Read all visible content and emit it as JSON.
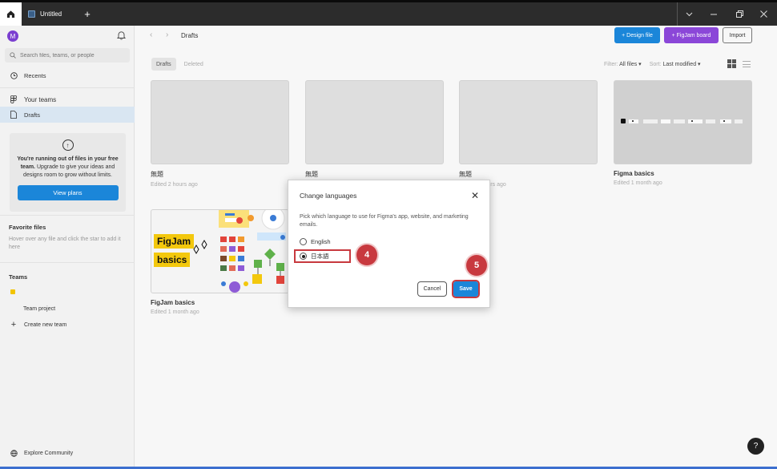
{
  "titlebar": {
    "tab_title": "Untitled",
    "home_icon": "home-icon",
    "new_tab_icon": "plus-icon",
    "chevron_icon": "chevron-down-icon",
    "minimize_icon": "minimize-icon",
    "restore_icon": "restore-icon",
    "close_icon": "close-icon"
  },
  "sidebar": {
    "avatar_letter": "M",
    "search_placeholder": "Search files, teams, or people",
    "recents": "Recents",
    "your_teams": "Your teams",
    "drafts": "Drafts",
    "upgrade_bold": "You're running out of files in your free team.",
    "upgrade_text": "Upgrade to give your ideas and designs room to grow without limits.",
    "view_plans": "View plans",
    "favorite_files": "Favorite files",
    "favorite_hint": "Hover over any file and click the star to add it here",
    "teams": "Teams",
    "team_project": "Team project",
    "create_new_team": "Create new team",
    "explore_community": "Explore Community"
  },
  "main": {
    "breadcrumb": "Drafts",
    "design_file": "+ Design file",
    "figjam_board": "+ FigJam board",
    "import": "Import",
    "tabs": [
      "Drafts",
      "Deleted"
    ],
    "filter_label": "Filter:",
    "filter_value": "All files ▾",
    "sort_label": "Sort:",
    "sort_value": "Last modified ▾",
    "cards": [
      {
        "title": "無題",
        "sub": "Edited 2 hours ago"
      },
      {
        "title": "無題",
        "sub": ""
      },
      {
        "title": "無題",
        "sub": "Edited 3 hours ago"
      },
      {
        "title": "Figma basics",
        "sub": "Edited 1 month ago"
      },
      {
        "title": "FigJam basics",
        "sub": "Edited 1 month ago"
      }
    ],
    "figjam_thumb_l1": "FigJam",
    "figjam_thumb_l2": "basics"
  },
  "dialog": {
    "title": "Change languages",
    "description": "Pick which language to use for Figma's app, website, and marketing emails.",
    "option_english": "English",
    "option_japanese": "日本語",
    "selected": "日本語",
    "cancel": "Cancel",
    "save": "Save"
  },
  "annotations": {
    "step4": "4",
    "step5": "5",
    "highlight_color": "#c8393f"
  },
  "help": "?",
  "colors": {
    "primary_blue": "#1b86d9",
    "figjam_purple": "#8b47d8",
    "avatar_purple": "#7b3fd0"
  }
}
